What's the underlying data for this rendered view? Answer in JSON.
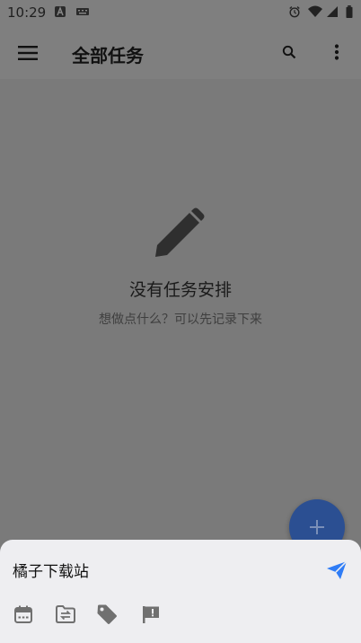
{
  "status_bar": {
    "time": "10:29",
    "icons": [
      "a-icon",
      "keyboard-icon",
      "alarm-icon",
      "wifi-icon",
      "signal-icon",
      "battery-icon"
    ]
  },
  "app_bar": {
    "title": "全部任务",
    "icons": [
      "menu-icon",
      "search-icon",
      "more-vert-icon"
    ]
  },
  "empty_state": {
    "icon": "pencil-icon",
    "title": "没有任务安排",
    "subtitle": "想做点什么？可以先记录下来"
  },
  "fab": {
    "icon": "plus-icon",
    "color": "#2b4f92"
  },
  "quick_add": {
    "input_value": "橘子下载站",
    "send_icon": "send-icon",
    "send_color": "#2f7cf6",
    "tools": [
      "calendar-icon",
      "folder-move-icon",
      "tag-icon",
      "flag-icon"
    ]
  },
  "colors": {
    "scrim": "#7a7a7a",
    "sheet": "#eeeef1"
  }
}
